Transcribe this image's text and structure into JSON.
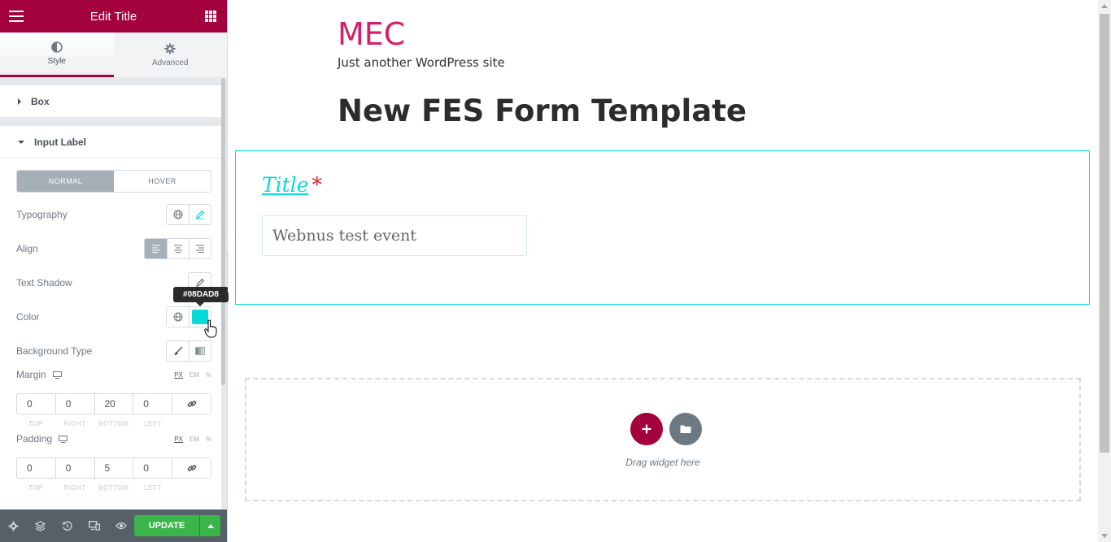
{
  "panel": {
    "title": "Edit Title",
    "tabs": [
      {
        "label": "Style",
        "icon": "half-circle-icon"
      },
      {
        "label": "Advanced",
        "icon": "gear-icon"
      }
    ],
    "sections": [
      {
        "label": "Box",
        "expanded": false
      },
      {
        "label": "Input Label",
        "expanded": true
      }
    ],
    "state_toggle": {
      "normal": "NORMAL",
      "hover": "HOVER",
      "selected": "NORMAL"
    },
    "controls": {
      "typography": "Typography",
      "align": "Align",
      "text_shadow": "Text Shadow",
      "color": "Color",
      "background_type": "Background Type"
    },
    "color_value": "#08DAD8",
    "tooltip": "#08DAD8",
    "margin": {
      "label": "Margin",
      "units": [
        "PX",
        "EM",
        "%"
      ],
      "top": "0",
      "right": "0",
      "bottom": "20",
      "left": "0",
      "labels": [
        "TOP",
        "RIGHT",
        "BOTTOM",
        "LEFT"
      ]
    },
    "padding": {
      "label": "Padding",
      "units": [
        "PX",
        "EM",
        "%"
      ],
      "top": "0",
      "right": "0",
      "bottom": "5",
      "left": "0",
      "labels": [
        "TOP",
        "RIGHT",
        "BOTTOM",
        "LEFT"
      ]
    },
    "footer": {
      "update_label": "UPDATE"
    }
  },
  "site": {
    "title": "MEC",
    "tagline": "Just another WordPress site",
    "page_title": "New FES Form Template"
  },
  "form": {
    "field_label": "Title",
    "required_mark": "*",
    "field_value": "Webnus test event"
  },
  "drop_zone": {
    "text": "Drag widget here"
  },
  "colors": {
    "brand": "#a3023d",
    "accent": "#08dad8",
    "update": "#39b54a"
  }
}
